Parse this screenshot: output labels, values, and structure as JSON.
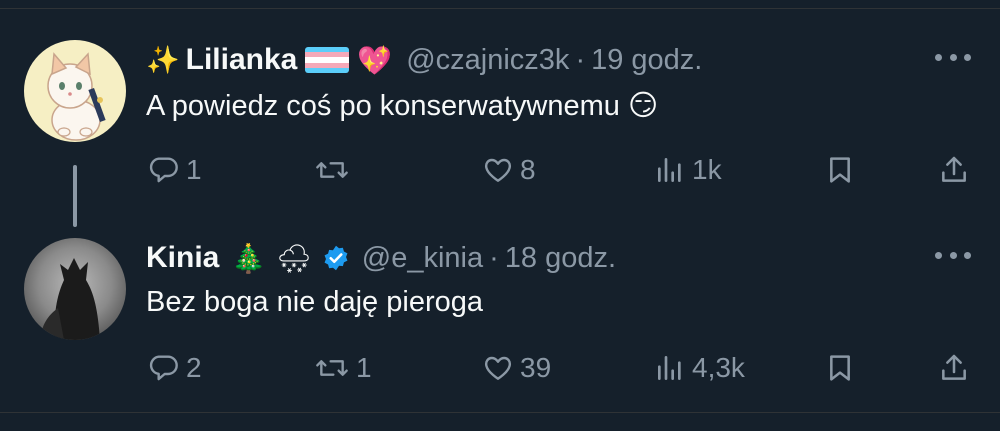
{
  "tweets": [
    {
      "name": "Lilianka",
      "name_prefix_emoji": "✨",
      "flag_emoji": "trans-flag",
      "suffix_emoji": "💖",
      "handle": "@czajnicz3k",
      "separator": "·",
      "time": "19 godz.",
      "text": "A powiedz coś po konserwatywnemu 😏",
      "replies": "1",
      "retweets": "",
      "likes": "8",
      "views": "1k",
      "avatar": "cat-avatar"
    },
    {
      "name": "Kinia",
      "emoji1": "🎄",
      "emoji2": "🌨",
      "verified": "verified-badge",
      "handle": "@e_kinia",
      "separator": "·",
      "time": "18 godz.",
      "text": "Bez boga nie daję pieroga",
      "replies": "2",
      "retweets": "1",
      "likes": "39",
      "views": "4,3k",
      "avatar": "dark-silhouette-avatar"
    }
  ],
  "colors": {
    "background": "#15202b",
    "text": "#f7f9f9",
    "muted": "#8b98a5",
    "verified": "#1d9bf0"
  }
}
